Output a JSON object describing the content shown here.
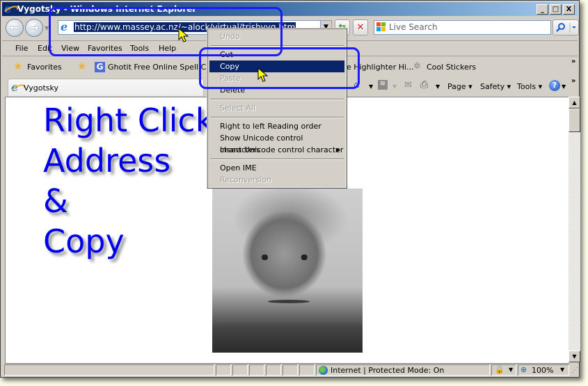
{
  "window": {
    "title": "Vygotsky - Windows Internet Explorer",
    "caption_buttons": {
      "minimize": "_",
      "maximize": "□",
      "close": "X"
    }
  },
  "navigation": {
    "back_icon": "back-arrow-icon",
    "forward_icon": "forward-arrow-icon",
    "address_url": "http://www.massey.ac.nz/~alock/virtual/trishvyg.htm",
    "refresh_icon": "refresh-icon",
    "stop_icon": "stop-icon",
    "search_placeholder": "Live Search",
    "search_icon": "magnifier-icon"
  },
  "menubar": {
    "items": [
      "File",
      "Edit",
      "View",
      "Favorites",
      "Tools",
      "Help"
    ]
  },
  "favorites_bar": {
    "favorites_label": "Favorites",
    "items": [
      {
        "label": "Ghotit Free Online Spell Che...",
        "icon": "ghotit-g-icon"
      },
      {
        "label": "e Highlighter  Hi...",
        "icon": "highlighter-icon"
      },
      {
        "label": "Cool Stickers",
        "icon": "sticker-icon"
      }
    ],
    "overflow": "»"
  },
  "tabs": [
    {
      "title": "Vygotsky",
      "active": true
    }
  ],
  "command_bar": {
    "items": [
      "Page",
      "Safety",
      "Tools"
    ],
    "overflow": "»",
    "help_icon": "help-icon"
  },
  "context_menu": {
    "items": [
      {
        "label": "Undo",
        "disabled": true
      },
      {
        "separator": true
      },
      {
        "label": "Cut",
        "disabled": false
      },
      {
        "label": "Copy",
        "disabled": false,
        "selected": true
      },
      {
        "label": "Paste",
        "disabled": true
      },
      {
        "label": "Delete",
        "disabled": false
      },
      {
        "separator": true
      },
      {
        "label": "Select All",
        "disabled": true
      },
      {
        "separator": true
      },
      {
        "label": "Right to left Reading order",
        "disabled": false
      },
      {
        "label": "Show Unicode control characters",
        "disabled": false
      },
      {
        "label": "Insert Unicode control character",
        "disabled": false,
        "submenu": true
      },
      {
        "separator": true
      },
      {
        "label": "Open IME",
        "disabled": false
      },
      {
        "label": "Reconversion",
        "disabled": true
      }
    ]
  },
  "content": {
    "annotation_lines": [
      "Right Click",
      "Address",
      "&",
      "Copy"
    ],
    "photo_alt": "Portrait photograph of Vygotsky"
  },
  "statusbar": {
    "zone_text": "Internet | Protected Mode: On",
    "zoom": "100%"
  },
  "colors": {
    "annotation_blue": "#0000ee",
    "highlight_box": "#1a1aff",
    "selection": "#0a246a",
    "chrome": "#d4d0c8"
  }
}
